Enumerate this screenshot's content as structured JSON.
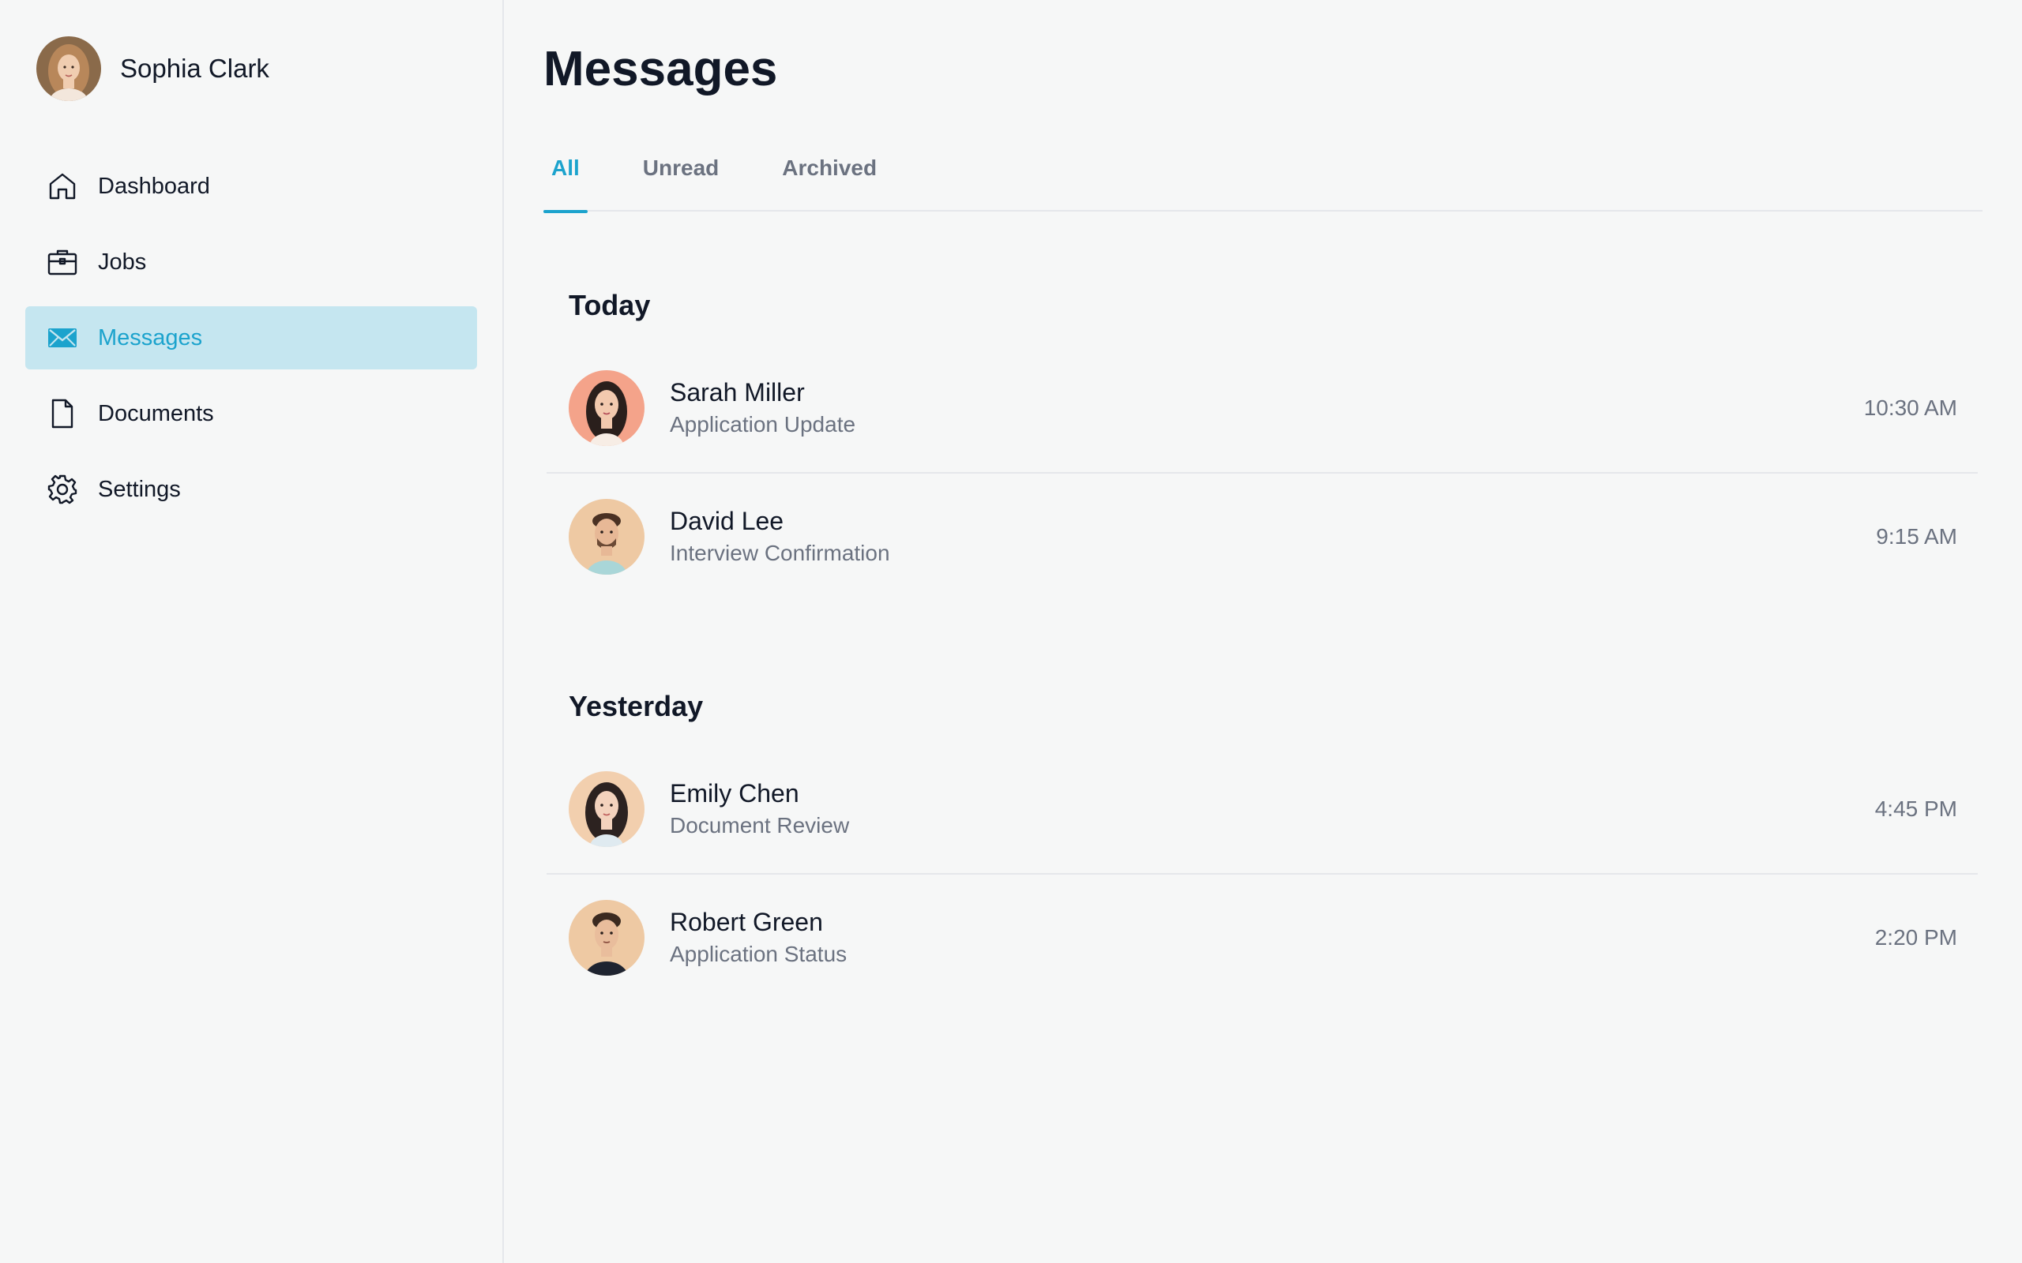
{
  "user": {
    "name": "Sophia Clark"
  },
  "sidebar": {
    "items": [
      {
        "label": "Dashboard",
        "icon": "home-icon",
        "active": false
      },
      {
        "label": "Jobs",
        "icon": "briefcase-icon",
        "active": false
      },
      {
        "label": "Messages",
        "icon": "envelope-icon",
        "active": true
      },
      {
        "label": "Documents",
        "icon": "document-icon",
        "active": false
      },
      {
        "label": "Settings",
        "icon": "gear-icon",
        "active": false
      }
    ]
  },
  "main": {
    "title": "Messages",
    "tabs": [
      {
        "label": "All",
        "active": true
      },
      {
        "label": "Unread",
        "active": false
      },
      {
        "label": "Archived",
        "active": false
      }
    ],
    "sections": [
      {
        "title": "Today",
        "messages": [
          {
            "name": "Sarah Miller",
            "subject": "Application Update",
            "time": "10:30 AM"
          },
          {
            "name": "David Lee",
            "subject": "Interview Confirmation",
            "time": "9:15 AM"
          }
        ]
      },
      {
        "title": "Yesterday",
        "messages": [
          {
            "name": "Emily Chen",
            "subject": "Document Review",
            "time": "4:45 PM"
          },
          {
            "name": "Robert Green",
            "subject": "Application Status",
            "time": "2:20 PM"
          }
        ]
      }
    ]
  },
  "colors": {
    "accent": "#1ca3cd",
    "active_bg": "#c5e6f0",
    "background": "#f6f7f7",
    "text": "#111827",
    "muted": "#6b7280"
  }
}
